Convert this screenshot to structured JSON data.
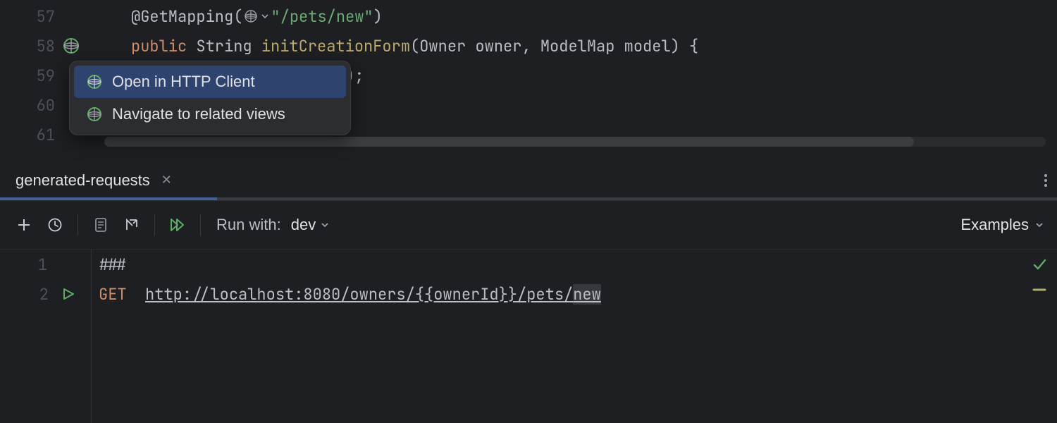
{
  "upper_editor": {
    "lines": [
      {
        "num": "57"
      },
      {
        "num": "58"
      },
      {
        "num": "59"
      },
      {
        "num": "60"
      },
      {
        "num": "61"
      }
    ],
    "code": {
      "anno_at": "@",
      "anno_name": "GetMapping",
      "anno_paren_open": "(",
      "mapping_path": "\"/pets/new\"",
      "anno_paren_close": ")",
      "pub": "public",
      "ret": "String",
      "method": "initCreationForm",
      "sig_open": "(",
      "p1t": "Owner",
      "p1n": " owner",
      "comma": ", ",
      "p2t": "ModelMap",
      "p2n": " model",
      "sig_close": ") {",
      "line3_tail": ");",
      "line4_tail": ""
    }
  },
  "popup": {
    "items": [
      {
        "label": "Open in HTTP Client"
      },
      {
        "label": "Navigate to related views"
      }
    ]
  },
  "tab": {
    "name": "generated-requests"
  },
  "toolbar": {
    "run_label": "Run with:",
    "run_value": "dev",
    "examples_label": "Examples"
  },
  "lower_editor": {
    "lines": [
      {
        "num": "1"
      },
      {
        "num": "2"
      }
    ],
    "line1": "###",
    "method": "GET",
    "url_prefix": "http://localhost:8080/owners/{{ownerId}}/pets/",
    "url_caret": "new"
  }
}
